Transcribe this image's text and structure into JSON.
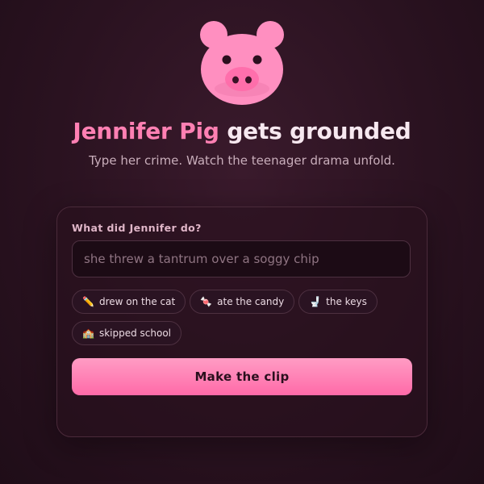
{
  "header": {
    "title_name": "Jennifer Pig",
    "title_rest": "gets grounded",
    "subtitle": "Type her crime. Watch the teenager drama unfold."
  },
  "form": {
    "label": "What did Jennifer do?",
    "input_placeholder": "she threw a tantrum over a soggy chip",
    "input_value": "",
    "suggestions": [
      {
        "icon": "✏️",
        "icon_name": "pencil-icon",
        "label": "drew on the cat"
      },
      {
        "icon": "🍬",
        "icon_name": "candy-icon",
        "label": "ate the candy"
      },
      {
        "icon": "🚽",
        "icon_name": "toilet-icon",
        "label": "the keys"
      },
      {
        "icon": "🏫",
        "icon_name": "school-icon",
        "label": "skipped school"
      }
    ],
    "submit_label": "Make the clip"
  },
  "colors": {
    "accent": "#ff80b3",
    "button_top": "#ff9cc4",
    "button_bottom": "#ff6aa8",
    "pig_pink": "#ff8fc0",
    "background": "#2a1220"
  }
}
